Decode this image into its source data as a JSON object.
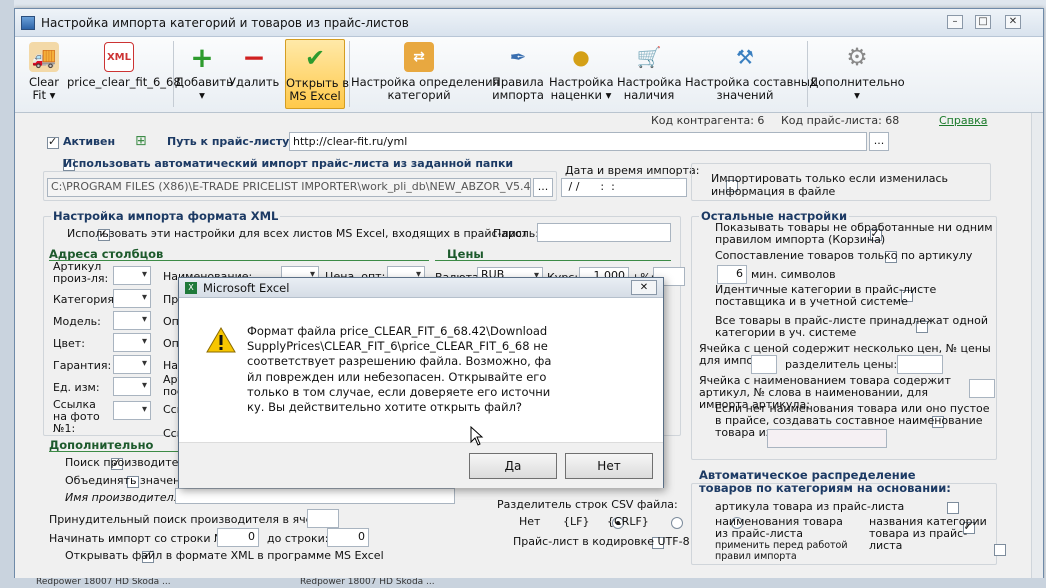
{
  "window": {
    "title": "Настройка импорта категорий и товаров из прайс-листов"
  },
  "toolbar": {
    "clear_fit": "Clear\nFit ▾",
    "price_file": "price_clear_fit_6_68",
    "add": "Добавить\n▾",
    "delete": "Удалить",
    "open_excel": "Открыть в\nMS Excel",
    "cat_settings": "Настройка определения\nкатегорий",
    "import_rules": "Правила\nимпорта",
    "markup": "Настройка\nнаценки ▾",
    "availability": "Настройка\nналичия",
    "composite": "Настройка составных\nзначений",
    "extra": "Дополнительно\n▾"
  },
  "info": {
    "contractor_code": "Код контрагента: 6",
    "price_code": "Код прайс-листа: 68",
    "help": "Справка"
  },
  "main": {
    "active": "Активен",
    "path_label": "Путь к прайс-листу:",
    "path_value": "http://clear-fit.ru/yml",
    "auto_import": "Использовать автоматический импорт прайс-листа из заданной папки",
    "folder_value": "C:\\PROGRAM FILES (X86)\\E-TRADE PRICELIST IMPORTER\\work_pli_db\\NEW_ABZOR_V5.42\\Download",
    "datetime_label": "Дата и время импорта:",
    "datetime_value": " / /      :  :",
    "only_changed": "Импортировать только если изменилась информация в файле"
  },
  "xml": {
    "header": "Настройка импорта формата XML",
    "use_all": "Использовать эти настройки для всех листов MS Excel, входящих в прайс-лист",
    "password": "Пароль:",
    "columns_hdr": "Адреса столбцов",
    "prices_hdr": "Цены",
    "article": "Артикул произ-ля:",
    "name": "Наименование:",
    "price_opt": "Цена, опт:",
    "currency": "Валюта:",
    "currency_value": "RUB",
    "rate": "Курс:",
    "rate_value": "1,000",
    "plus_pct": "+%:",
    "category": "Категория:",
    "model": "Модель:",
    "color": "Цвет:",
    "warranty": "Гарантия:",
    "unit": "Ед. изм:",
    "photo": "Ссылка на фото №1:",
    "pr": "Пре",
    "op1": "Оп",
    "op2": "Оп",
    "op3": "Оп",
    "na": "На",
    "art": "Арт",
    "pos": "пос",
    "ssy": "Ссы",
    "ssy2": "Ссь"
  },
  "extra": {
    "header": "Дополнительно",
    "search_mfr": "Поиск производителя",
    "merge_values": "Объединять значение",
    "mfr_name": "Имя производителя:",
    "forced_search": "Принудительный поиск производителя в ячейке:",
    "start_row": "Начинать импорт со строки №:",
    "start_value": "0",
    "to_row": "до строки:",
    "to_value": "0",
    "open_xml": "Открывать файл в формате XML в программе MS Excel",
    "csv_sep": "Разделитель строк CSV файла:",
    "r_no": "Нет",
    "r_lf": "{LF}",
    "r_crlf": "{CRLF}",
    "utf8": "Прайс-лист в кодировке UTF-8"
  },
  "other": {
    "header": "Остальные настройки",
    "show_unprocessed": "Показывать товары не обработанные ни одним правилом импорта (Корзина)",
    "match_article": "Сопоставление товаров только по артикулу",
    "min_chars_value": "6",
    "min_chars": "мин. символов",
    "identical_cats": "Идентичные категории в прайс-листе поставщика и в учетной системе",
    "one_cat": "Все товары в прайс-листе принадлежат одной категории в уч. системе",
    "multi_price": "Ячейка с ценой содержит несколько цен, № цены для импорта:",
    "price_sep": "разделитель цены:",
    "name_has_article": "Ячейка с наименованием товара содержит артикул, № слова в наименовании, для импорта артикула:",
    "composite_name": "Если нет наименования товара или оно пустое в прайсе, создавать составное наименование товара из ячеек:"
  },
  "auto": {
    "header": "Автоматическое распределение товаров по категориям на основании:",
    "by_article": "артикула товара из прайс-листа",
    "by_name": "наименования товара из прайс-листа",
    "by_cat_names": "названия  категории товара из прайс-листа",
    "apply_before": "применить перед работой правил импорта"
  },
  "dialog": {
    "title": "Microsoft Excel",
    "message": "Формат файла price_CLEAR_FIT_6_68.42\\DownloadSupplyPrices\\CLEAR_FIT_6\\price_CLEAR_FIT_6_68 не соответствует разрешению файла. Возможно, файл поврежден или небезопасен. Открывайте его только в том случае, если доверяете его источнику. Вы действительно хотите открыть файл?",
    "yes": "Да",
    "no": "Нет"
  },
  "taskbar": {
    "left": "Redpower 18007 HD Skoda ...",
    "right": "Redpower 18007 HD Skoda ..."
  }
}
